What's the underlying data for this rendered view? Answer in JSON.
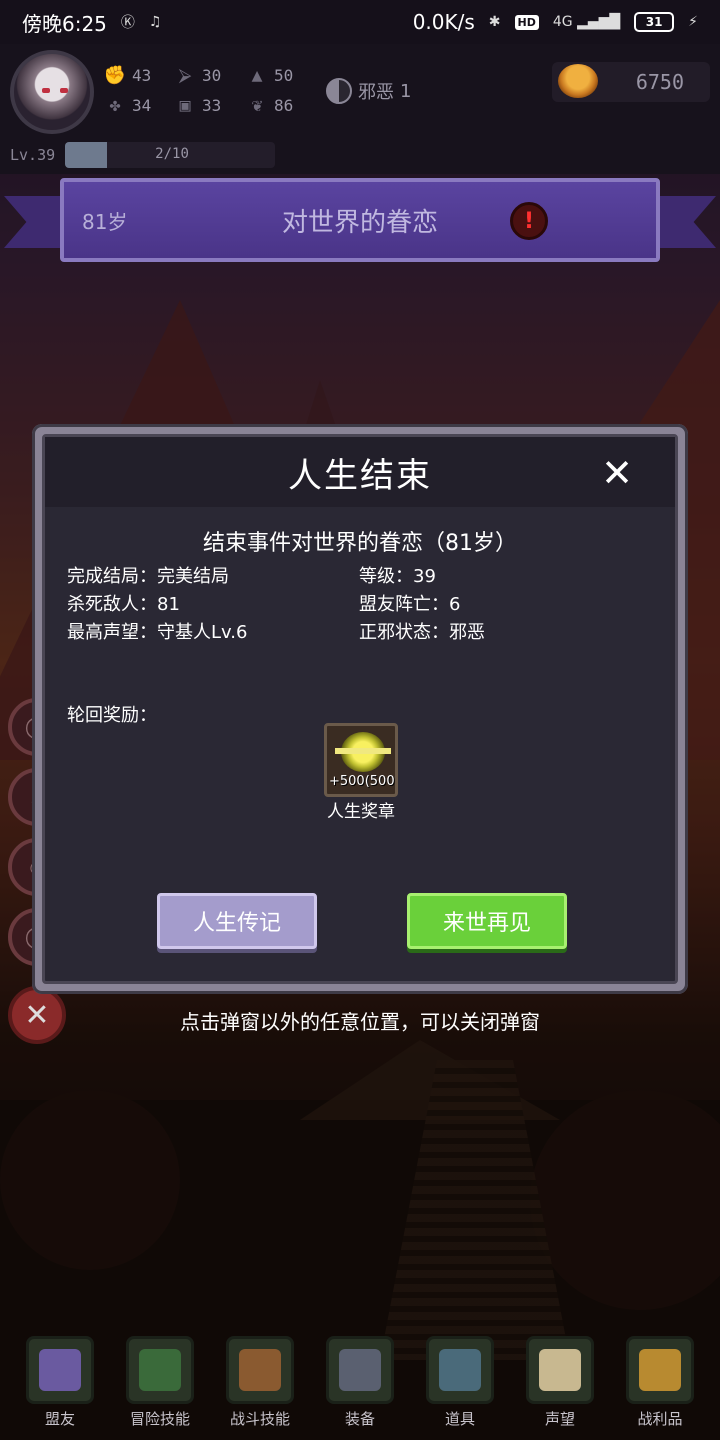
{
  "status_bar": {
    "time": "傍晚6:25",
    "net_speed": "0.0K/s",
    "hd": "HD",
    "network": "4G",
    "battery": "31"
  },
  "player": {
    "stats": [
      {
        "icon": "fist-icon",
        "value": "43"
      },
      {
        "icon": "clover-icon",
        "value": "34"
      },
      {
        "icon": "boot-icon",
        "value": "30"
      },
      {
        "icon": "chest-icon",
        "value": "33"
      },
      {
        "icon": "wizard-hat-icon",
        "value": "50"
      },
      {
        "icon": "lotus-icon",
        "value": "86"
      }
    ],
    "alignment": "邪恶",
    "alignment_value": "1",
    "gold": "6750",
    "level": "Lv.39",
    "xp_text": "2/10",
    "xp_fraction": 0.2
  },
  "event_banner": {
    "age": "81岁",
    "title": "对世界的眷恋",
    "warning": "!"
  },
  "modal": {
    "title": "人生结束",
    "close": "✕",
    "subtitle": "结束事件对世界的眷恋（81岁）",
    "info_left": [
      "完成结局：完美结局",
      "杀死敌人：81",
      "最高声望：守基人Lv.6"
    ],
    "info_right": [
      "等级：39",
      "盟友阵亡：6",
      "正邪状态：邪恶"
    ],
    "reward_label": "轮回奖励：",
    "reward": {
      "qty": "+500(500",
      "name": "人生奖章",
      "icon": "medal-icon"
    },
    "buttons": {
      "biography": "人生传记",
      "next_life": "来世再见"
    }
  },
  "hint": "点击弹窗以外的任意位置，可以关闭弹窗",
  "nav": [
    {
      "label": "盟友",
      "icon": "ally-icon",
      "color": "#6a5aa0"
    },
    {
      "label": "冒险技能",
      "icon": "book-icon",
      "color": "#3a6a3a"
    },
    {
      "label": "战斗技能",
      "icon": "backpack-icon",
      "color": "#8a5a30"
    },
    {
      "label": "装备",
      "icon": "swords-icon",
      "color": "#5a6070"
    },
    {
      "label": "道具",
      "icon": "pouch-icon",
      "color": "#4a6a7a"
    },
    {
      "label": "声望",
      "icon": "scroll-icon",
      "color": "#c8b890"
    },
    {
      "label": "战利品",
      "icon": "treasure-chest-icon",
      "color": "#b88a30"
    }
  ]
}
